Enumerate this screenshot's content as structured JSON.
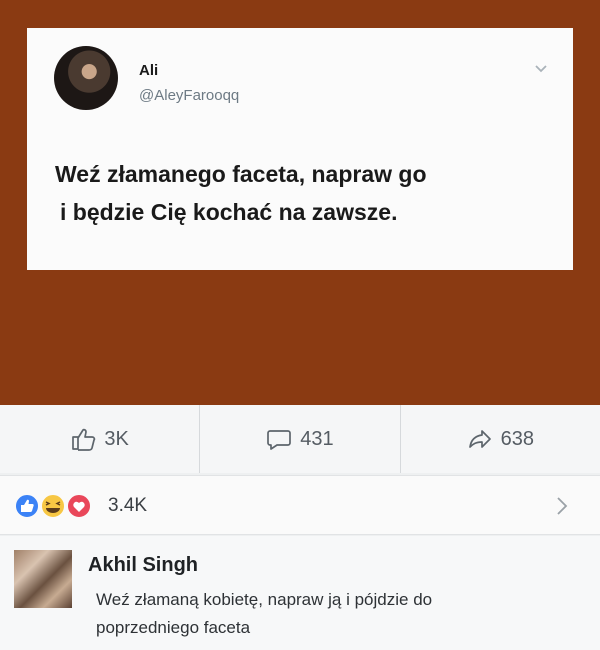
{
  "tweet": {
    "name": "Ali",
    "handle": "@AleyFarooqq",
    "text_line1": "Weź złamanego faceta, napraw go",
    "text_line2": "i będzie Cię kochać na zawsze."
  },
  "actions": {
    "like_count": "3K",
    "comment_count": "431",
    "share_count": "638"
  },
  "reactions": {
    "count": "3.4K",
    "icons": [
      "like-icon",
      "haha-icon",
      "love-icon"
    ]
  },
  "comment": {
    "author": "Akhil Singh",
    "text": "Weź złamaną kobietę, napraw ją i pójdzie do poprzedniego faceta"
  },
  "colors": {
    "background_brown": "#8a3a12",
    "like_blue": "#3b82f6",
    "haha_yellow": "#f7c744",
    "love_red": "#e9475a"
  }
}
